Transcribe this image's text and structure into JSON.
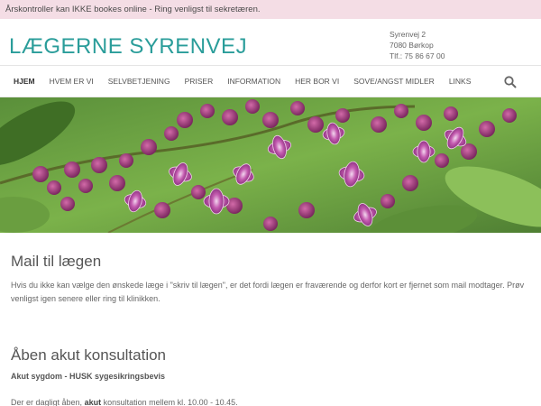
{
  "notice": {
    "text": "Årskontroller kan IKKE bookes online - Ring venligst til sekretæren."
  },
  "header": {
    "logo": "LÆGERNE SYRENVEJ",
    "address": {
      "street": "Syrenvej 2",
      "city": "7080 Børkop",
      "phone": "Tlf.: 75 86 67 00"
    }
  },
  "nav": {
    "items": [
      {
        "label": "HJEM",
        "active": true
      },
      {
        "label": "HVEM ER VI",
        "active": false
      },
      {
        "label": "SELVBETJENING",
        "active": false
      },
      {
        "label": "PRISER",
        "active": false
      },
      {
        "label": "INFORMATION",
        "active": false
      },
      {
        "label": "HER BOR VI",
        "active": false
      },
      {
        "label": "SOVE/ANGST MIDLER",
        "active": false
      },
      {
        "label": "LINKS",
        "active": false
      }
    ],
    "search_icon": "search-icon"
  },
  "hero": {
    "image": "lilac-flowers-banner"
  },
  "content": {
    "mail_heading": "Mail til lægen",
    "mail_text": "Hvis du ikke kan vælge den ønskede læge i \"skriv til lægen\", er det fordi lægen er fraværende og derfor kort er fjernet som mail modtager. Prøv venligst igen senere eller ring til klinikken.",
    "akut_heading": "Åben akut konsultation",
    "akut_bold": "Akut sygdom - HUSK sygesikringsbevis",
    "daily_prefix": "Der er dagligt åben, ",
    "daily_bold": "akut",
    "daily_suffix": " konsultation mellem kl. 10.00 - 10.45."
  },
  "colors": {
    "brand": "#2a9d9a",
    "notice_bg": "#f4dde5",
    "lilac": "#b44a9e"
  }
}
